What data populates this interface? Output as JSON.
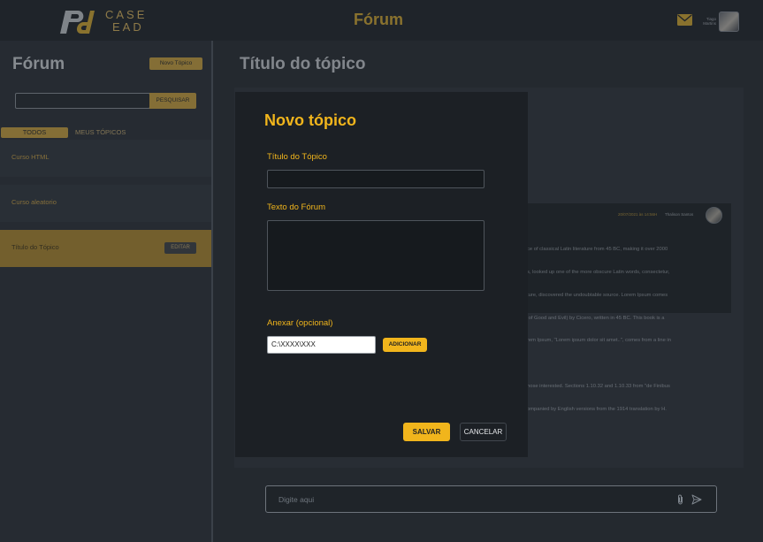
{
  "header": {
    "logo_text_line1": "CASE",
    "logo_text_line2": "EAD",
    "title": "Fórum",
    "user_name_line1": "Tiago",
    "user_name_line2": "Martins",
    "icons": {
      "mail": "mail-icon",
      "avatar": "user-avatar"
    }
  },
  "sidebar": {
    "title": "Fórum",
    "new_topic_label": "Novo Tópico",
    "search": {
      "placeholder": "",
      "button_label": "PESQUISAR"
    },
    "tabs": [
      {
        "label": "TODOS",
        "active": true
      },
      {
        "label": "MEUS TÓPICOS",
        "active": false
      }
    ],
    "courses": [
      {
        "label": "Curso HTML"
      },
      {
        "label": "Curso aleatorio"
      },
      {
        "label": "Título do Tópico",
        "active": true,
        "edit_label": "EDITAR"
      }
    ]
  },
  "main": {
    "title": "Título do tópico",
    "message": {
      "time": "20/07/2021 às 14:56H",
      "author": "Thalison Santos",
      "text_lines": [
        "ce of classical Latin literature from 45 BC, making it over 2000",
        "s, looked up one of the more obscure Latin words, consectetur,",
        "ture, discovered the undoubtable source. Lorem Ipsum comes",
        " of Good and Evil) by Cicero, written in 45 BC. This book is a",
        "rem Ipsum, \"Lorem ipsum dolor sit amet..\", comes from a line in",
        "",
        "hose interested. Sections 1.10.32 and 1.10.33 from \"de Finibus",
        "ompanied by English versions from the 1914 translation by H."
      ]
    },
    "chat": {
      "placeholder": "Digite aqui",
      "icons": {
        "attach": "paperclip-icon",
        "send": "send-icon"
      }
    }
  },
  "modal": {
    "title": "Novo tópico",
    "topic_title_label": "Título do Tópico",
    "topic_title_value": "",
    "forum_text_label": "Texto do Fórum",
    "forum_text_value": "",
    "attach_label": "Anexar (opcional)",
    "attach_path": "C:\\XXXX\\XXX",
    "add_label": "ADICIONAR",
    "save_label": "SALVAR",
    "cancel_label": "CANCELAR"
  },
  "colors": {
    "accent": "#f1b51c",
    "accent_muted": "#d1a63a",
    "background": "#24292f",
    "modal_background": "#1c2025"
  }
}
